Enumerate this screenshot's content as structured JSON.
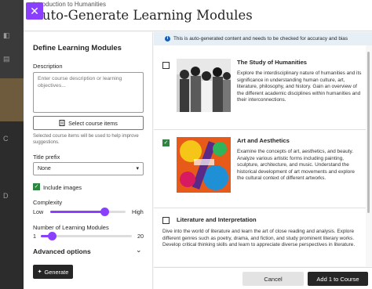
{
  "header": {
    "breadcrumb": "Introduction to Humanities",
    "title": "Auto-Generate Learning Modules",
    "close_icon": "close-icon"
  },
  "define": {
    "heading": "Define Learning Modules",
    "description_label": "Description",
    "description_placeholder": "Enter course description or learning objectives...",
    "select_items_label": "Select course items",
    "select_items_help": "Selected course items will be used to help improve suggestions.",
    "title_prefix_label": "Title prefix",
    "title_prefix_value": "None",
    "include_images_label": "Include images",
    "include_images_checked": true,
    "complexity_label": "Complexity",
    "complexity_low": "Low",
    "complexity_high": "High",
    "complexity_level": 0.72,
    "modules_label": "Number of Learning Modules",
    "modules_min": "1",
    "modules_max": "20",
    "modules_level": 0.12,
    "advanced_label": "Advanced options",
    "generate_label": "Generate"
  },
  "notice": {
    "text": "This is auto-generated content and needs to be checked for accuracy and bias",
    "icon": "info-icon"
  },
  "modules": [
    {
      "title": "The Study of Humanities",
      "description": "Explore the interdisciplinary nature of humanities and its significance in understanding human culture, art, literature, philosophy, and history. Gain an overview of the different academic disciplines within humanities and their interconnections.",
      "checked": false
    },
    {
      "title": "Art and Aesthetics",
      "description": "Examine the concepts of art, aesthetics, and beauty. Analyze various artistic forms including painting, sculpture, architecture, and music. Understand the historical development of art movements and explore the cultural context of different artworks.",
      "checked": true
    },
    {
      "title": "Literature and Interpretation",
      "description": "Dive into the world of literature and learn the art of close reading and analysis. Explore different genres such as poetry, drama, and fiction, and study prominent literary works. Develop critical thinking skills and learn to appreciate diverse perspectives in literature.",
      "checked": false
    }
  ],
  "footer": {
    "cancel_label": "Cancel",
    "add_label": "Add 1 to Course"
  },
  "colors": {
    "accent": "#8a3ffc",
    "checked_green": "#2e8540",
    "dark_button": "#262626",
    "notice_bg": "#e6eef6"
  }
}
